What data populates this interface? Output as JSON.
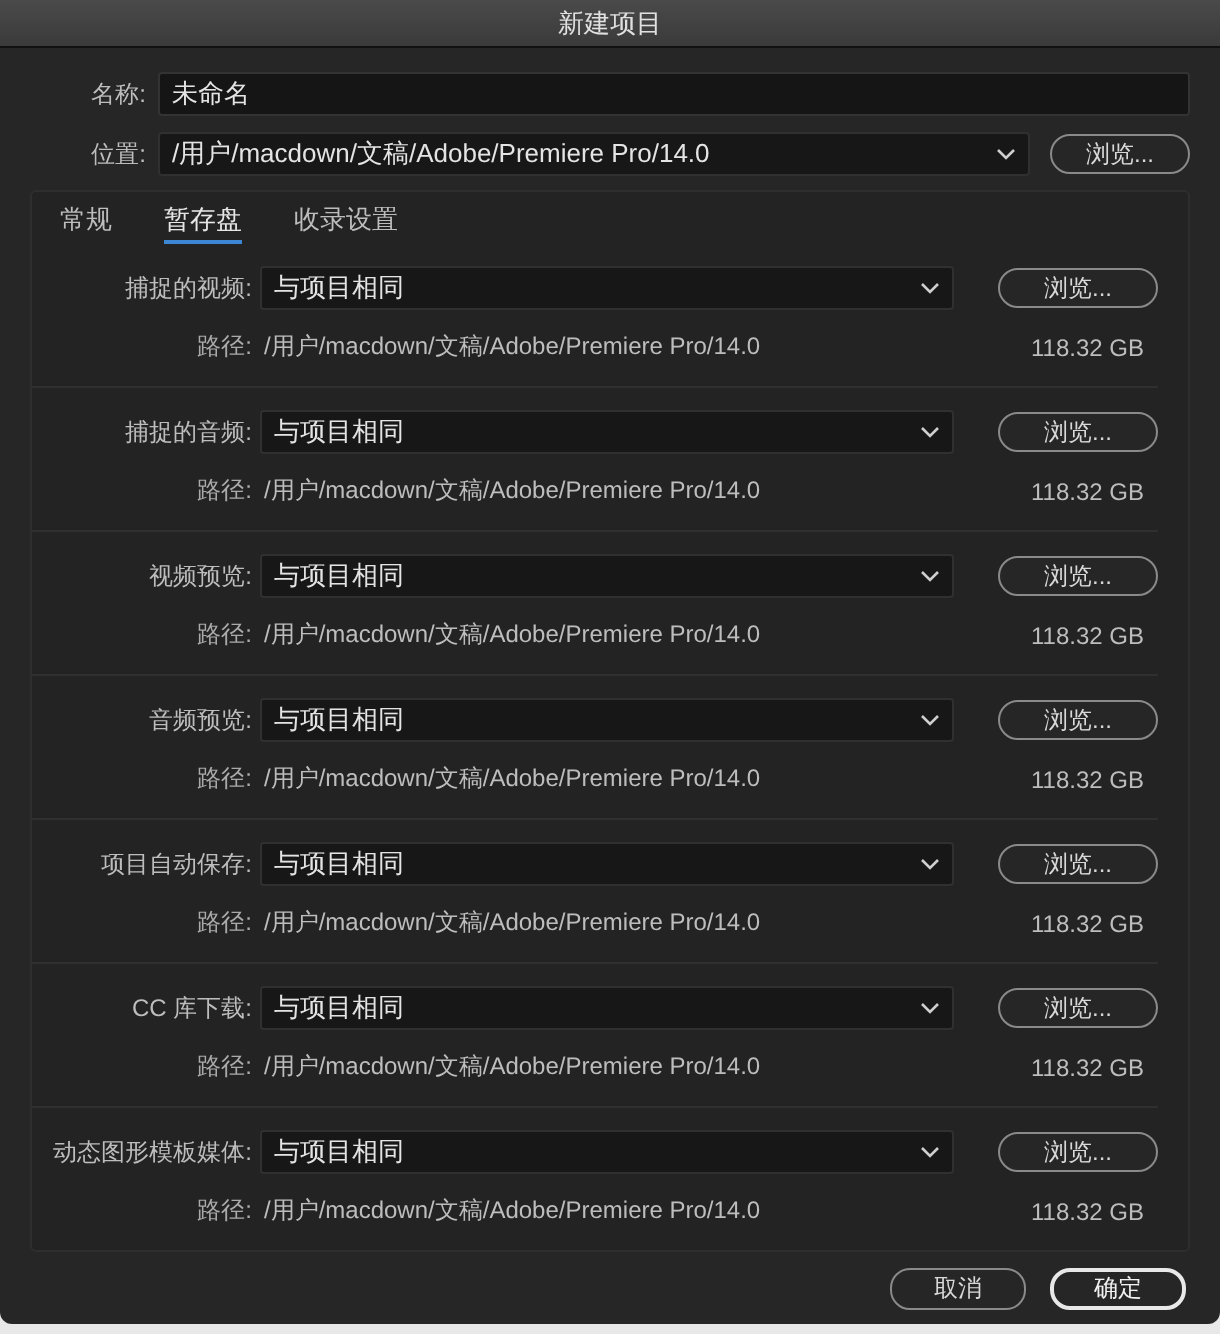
{
  "window": {
    "title": "新建项目"
  },
  "name_field": {
    "label": "名称:",
    "value": "未命名"
  },
  "location": {
    "label": "位置:",
    "value": "/用户/macdown/文稿/Adobe/Premiere Pro/14.0",
    "browse": "浏览..."
  },
  "tabs": [
    {
      "label": "常规",
      "selected": false
    },
    {
      "label": "暂存盘",
      "selected": true
    },
    {
      "label": "收录设置",
      "selected": false
    }
  ],
  "sections": [
    {
      "label": "捕捉的视频:",
      "value": "与项目相同",
      "browse": "浏览...",
      "path_label": "路径:",
      "path": "/用户/macdown/文稿/Adobe/Premiere Pro/14.0",
      "size": "118.32 GB"
    },
    {
      "label": "捕捉的音频:",
      "value": "与项目相同",
      "browse": "浏览...",
      "path_label": "路径:",
      "path": "/用户/macdown/文稿/Adobe/Premiere Pro/14.0",
      "size": "118.32 GB"
    },
    {
      "label": "视频预览:",
      "value": "与项目相同",
      "browse": "浏览...",
      "path_label": "路径:",
      "path": "/用户/macdown/文稿/Adobe/Premiere Pro/14.0",
      "size": "118.32 GB"
    },
    {
      "label": "音频预览:",
      "value": "与项目相同",
      "browse": "浏览...",
      "path_label": "路径:",
      "path": "/用户/macdown/文稿/Adobe/Premiere Pro/14.0",
      "size": "118.32 GB"
    },
    {
      "label": "项目自动保存:",
      "value": "与项目相同",
      "browse": "浏览...",
      "path_label": "路径:",
      "path": "/用户/macdown/文稿/Adobe/Premiere Pro/14.0",
      "size": "118.32 GB"
    },
    {
      "label": "CC 库下载:",
      "value": "与项目相同",
      "browse": "浏览...",
      "path_label": "路径:",
      "path": "/用户/macdown/文稿/Adobe/Premiere Pro/14.0",
      "size": "118.32 GB"
    },
    {
      "label": "动态图形模板媒体:",
      "value": "与项目相同",
      "browse": "浏览...",
      "path_label": "路径:",
      "path": "/用户/macdown/文稿/Adobe/Premiere Pro/14.0",
      "size": "118.32 GB"
    }
  ],
  "buttons": [
    {
      "label": "取消",
      "default": false
    },
    {
      "label": "确定",
      "default": true
    }
  ]
}
